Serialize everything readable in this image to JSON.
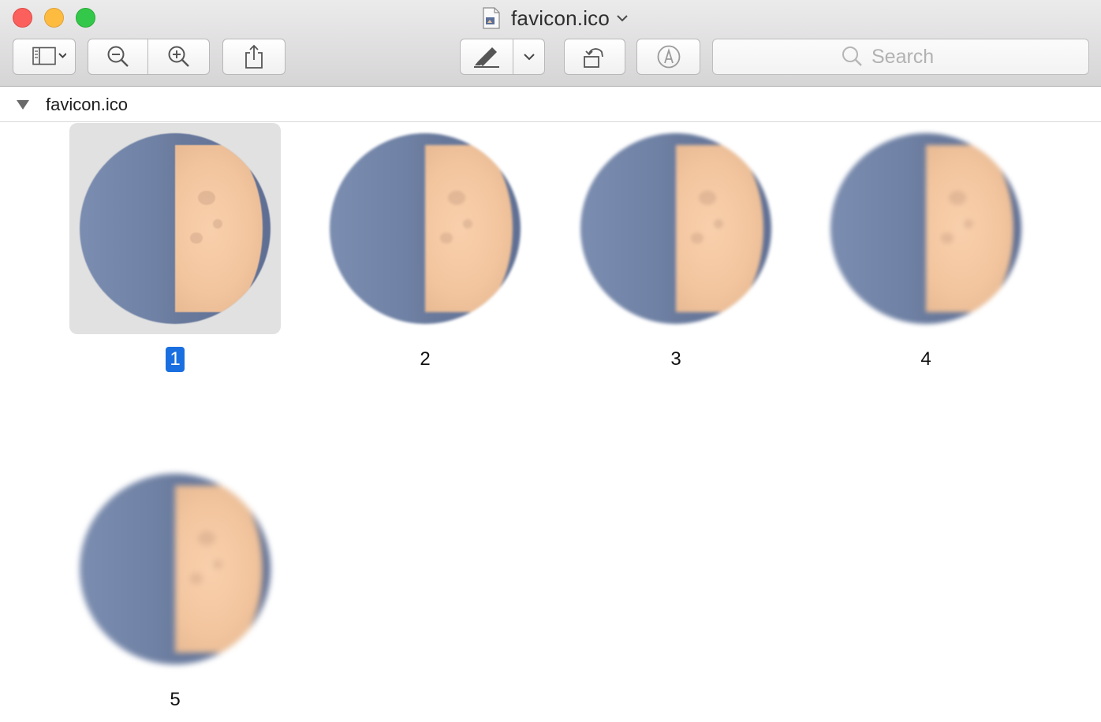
{
  "window": {
    "title": "favicon.ico"
  },
  "toolbar": {
    "sidebar_icon": "sidebar-icon",
    "zoom_out_icon": "zoom-out-icon",
    "zoom_in_icon": "zoom-in-icon",
    "share_icon": "share-icon",
    "markup_icon": "highlighter-icon",
    "rotate_icon": "rotate-icon",
    "annotate_icon": "annotate-icon",
    "search_placeholder": "Search"
  },
  "sidebar": {
    "group_label": "favicon.ico"
  },
  "pages": [
    {
      "label": "1",
      "selected": true
    },
    {
      "label": "2",
      "selected": false
    },
    {
      "label": "3",
      "selected": false
    },
    {
      "label": "4",
      "selected": false
    },
    {
      "label": "5",
      "selected": false
    }
  ],
  "colors": {
    "selection": "#1a6fe0",
    "moon_dark": "#6f81a4",
    "moon_lit": "#f2c59e"
  }
}
